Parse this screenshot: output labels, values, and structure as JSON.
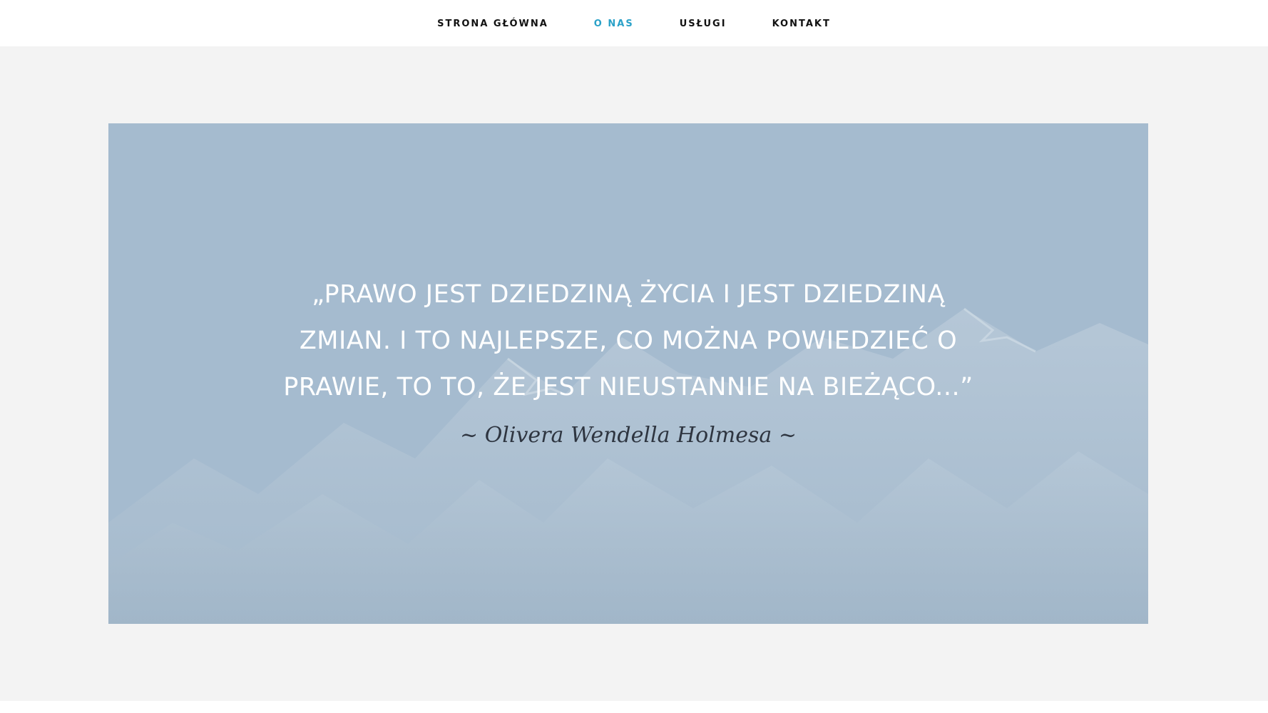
{
  "nav": {
    "items": [
      {
        "label": "STRONA GŁÓWNA",
        "active": false
      },
      {
        "label": "O NAS",
        "active": true
      },
      {
        "label": "USŁUGI",
        "active": false
      },
      {
        "label": "KONTAKT",
        "active": false
      }
    ],
    "active_color": "#2aa1c8",
    "text_color": "#111111"
  },
  "hero": {
    "quote": "„PRAWO JEST DZIEDZINĄ ŻYCIA I JEST DZIEDZINĄ ZMIAN. I TO NAJLEPSZE, CO MOŻNA POWIEDZIEĆ O PRAWIE, TO TO, ŻE JEST NIEUSTANNIE NA BIEŻĄCO...”",
    "author": "~ Olivera Wendella Holmesa ~",
    "background_color": "#a5bbcf"
  }
}
